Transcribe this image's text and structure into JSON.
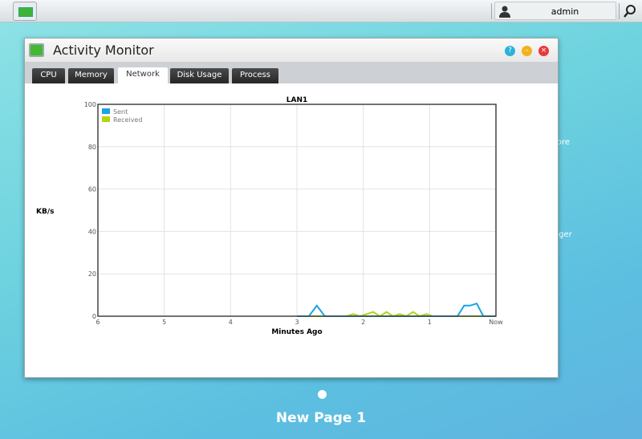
{
  "taskbar": {
    "user": "admin",
    "icons": [
      "activity-monitor-icon",
      "user-icon",
      "search-icon"
    ]
  },
  "desktop": {
    "page_caption": "New Page 1",
    "peek_labels": [
      "tore",
      "ager"
    ]
  },
  "window": {
    "title": "Activity Monitor",
    "buttons": [
      "help",
      "minimize",
      "close"
    ],
    "tabs": [
      {
        "label": "CPU"
      },
      {
        "label": "Memory"
      },
      {
        "label": "Network",
        "active": true
      },
      {
        "label": "Disk Usage"
      },
      {
        "label": "Process"
      }
    ]
  },
  "chart_data": {
    "type": "line",
    "title": "LAN1",
    "xlabel": "Minutes Ago",
    "ylabel": "KB/s",
    "ylim": [
      0,
      100
    ],
    "yticks": [
      "0",
      "20",
      "40",
      "60",
      "80",
      "100"
    ],
    "xlim": [
      6,
      0
    ],
    "xticks": [
      {
        "v": 6,
        "l": "6"
      },
      {
        "v": 5,
        "l": "5"
      },
      {
        "v": 4,
        "l": "4"
      },
      {
        "v": 3,
        "l": "3"
      },
      {
        "v": 2,
        "l": "2"
      },
      {
        "v": 1,
        "l": "1"
      },
      {
        "v": 0,
        "l": "Now"
      }
    ],
    "grid": true,
    "legend": "top-left",
    "series": [
      {
        "name": "Sent",
        "color": "#1aa3e8",
        "x": [
          3.0,
          2.82,
          2.7,
          2.58,
          0.58,
          0.48,
          0.39,
          0.29,
          0.19,
          0
        ],
        "y": [
          0,
          0,
          5,
          0,
          0,
          5,
          5,
          6,
          0,
          0
        ]
      },
      {
        "name": "Received",
        "color": "#b5d312",
        "x": [
          3.0,
          2.25,
          2.15,
          2.05,
          1.95,
          1.85,
          1.75,
          1.65,
          1.55,
          1.45,
          1.35,
          1.25,
          1.15,
          1.05,
          0.95,
          0
        ],
        "y": [
          0,
          0,
          1,
          0,
          1,
          2,
          0,
          2,
          0,
          1,
          0,
          2,
          0,
          1,
          0,
          0
        ]
      }
    ]
  }
}
